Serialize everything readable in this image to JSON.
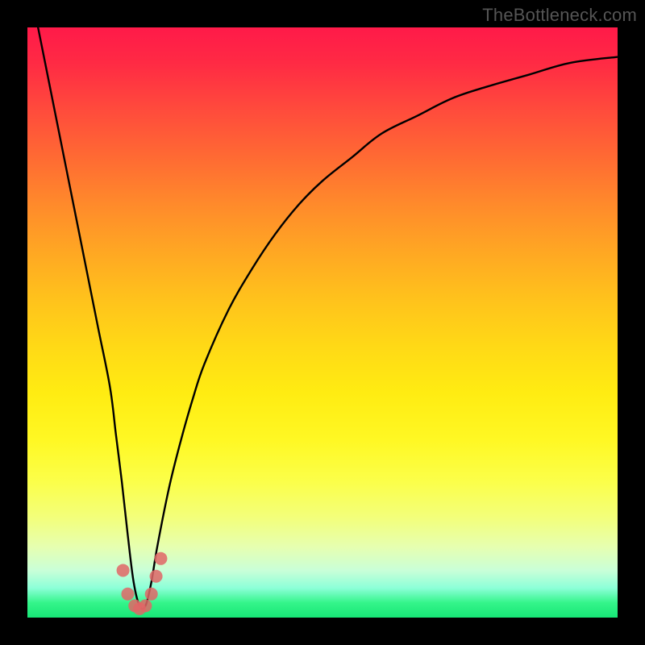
{
  "watermark": "TheBottleneck.com",
  "colors": {
    "frame": "#000000",
    "curve": "#000000",
    "marker": "#e06666"
  },
  "chart_data": {
    "type": "line",
    "title": "",
    "xlabel": "",
    "ylabel": "",
    "xlim": [
      0,
      100
    ],
    "ylim": [
      0,
      100
    ],
    "grid": false,
    "legend": false,
    "x": [
      0,
      2,
      4,
      6,
      8,
      10,
      12,
      14,
      15,
      16,
      17,
      18,
      19,
      20,
      21,
      22,
      24,
      26,
      28,
      30,
      34,
      38,
      42,
      46,
      50,
      55,
      60,
      66,
      72,
      78,
      85,
      92,
      100
    ],
    "y": [
      109,
      99,
      89,
      79,
      69,
      59,
      49,
      39,
      31,
      23,
      14,
      6,
      2,
      2,
      6,
      12,
      22,
      30,
      37,
      43,
      52,
      59,
      65,
      70,
      74,
      78,
      82,
      85,
      88,
      90,
      92,
      94,
      95
    ],
    "markers": {
      "x": [
        16.2,
        17.0,
        18.2,
        19.0,
        20.0,
        21.0,
        21.8,
        22.6
      ],
      "y": [
        8,
        4,
        2,
        1.5,
        2,
        4,
        7,
        10
      ]
    }
  }
}
